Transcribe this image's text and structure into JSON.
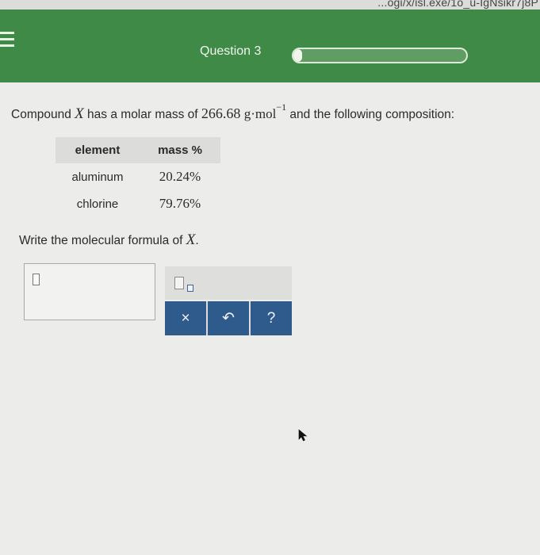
{
  "browser": {
    "url_fragment": "...ogi/x/isl.exe/1o_u-IgNsikr7j8P"
  },
  "header": {
    "question_title": "Question 3",
    "progress_fraction": 0.05
  },
  "question": {
    "intro": "Compound ",
    "compound_var": "X",
    "molar_text": " has a molar mass of ",
    "molar_value": "266.68",
    "unit": "g·mol",
    "unit_exp": "−1",
    "tail": " and the following composition:"
  },
  "table": {
    "headers": [
      "element",
      "mass %"
    ],
    "rows": [
      [
        "aluminum",
        "20.24%"
      ],
      [
        "chlorine",
        "79.76%"
      ]
    ]
  },
  "prompt": {
    "text": "Write the molecular formula of ",
    "var": "X",
    "end": "."
  },
  "toolbar": {
    "clear_label": "×",
    "undo_label": "↶",
    "help_label": "?"
  },
  "colors": {
    "header_green": "#3f8a46",
    "button_blue": "#2f5a8c"
  }
}
